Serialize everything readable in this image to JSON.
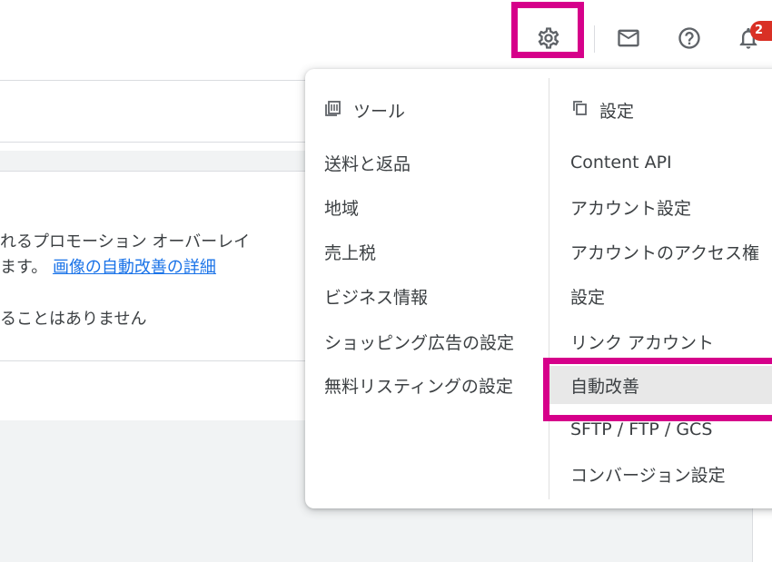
{
  "header": {
    "settings_icon": "gear-icon",
    "mail_icon": "mail-icon",
    "help_icon": "help-icon",
    "notifications_icon": "bell-icon",
    "notification_count": "2",
    "highlight_color": "#d6008a",
    "badge_color": "#d93025"
  },
  "background": {
    "line1": "れるプロモーション オーバーレイ",
    "line2_prefix": "ます。",
    "link": "画像の自動改善の詳細",
    "line3": "ることはありません",
    "link_color": "#1a73e8"
  },
  "menu": {
    "tools": {
      "heading": "ツール",
      "icon": "tools-icon",
      "items": [
        "送料と返品",
        "地域",
        "売上税",
        "ビジネス情報",
        "ショッピング広告の設定",
        "無料リスティングの設定"
      ]
    },
    "settings": {
      "heading": "設定",
      "icon": "settings-copy-icon",
      "items": [
        "Content API",
        "アカウント設定",
        "アカウントのアクセス権",
        "設定",
        "リンク アカウント",
        "自動改善",
        "SFTP / FTP / GCS",
        "コンバージョン設定"
      ],
      "selected": "自動改善"
    }
  }
}
